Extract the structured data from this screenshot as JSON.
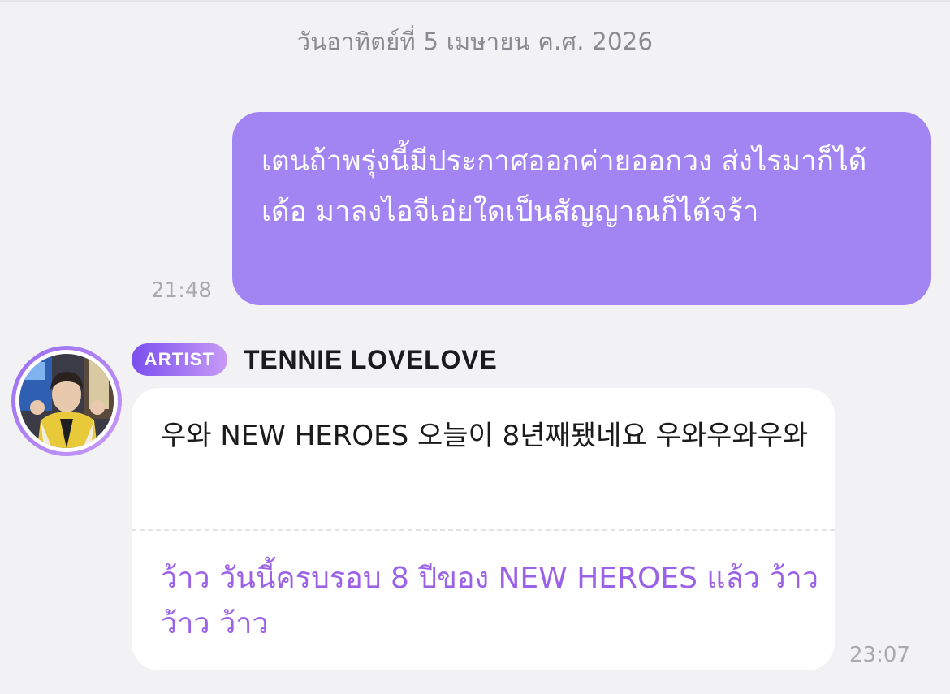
{
  "date_divider": "วันอาทิตย์ที่ 5 เมษายน ค.ศ. 2026",
  "sent_message": {
    "text": "เตนถ้าพรุ่งนี้มีประกาศออกค่ายออกวง ส่งไรมาก็ได้เด้อ มาลงไอจีเอ่ยใดเป็นสัญญาณก็ได้จร้า",
    "time": "21:48",
    "bubble_color": "#a284f3"
  },
  "received_message": {
    "badge": "ARTIST",
    "sender": "TENNIE LOVELOVE",
    "original_text": "우와 NEW HEROES 오늘이 8년째됐네요 우와우와우와",
    "translated_text": "ว้าว วันนี้ครบรอบ 8 ปีของ NEW HEROES แล้ว ว้าว ว้าว ว้าว",
    "time": "23:07",
    "translation_color": "#9b62e8",
    "avatar_icon": "artist-avatar"
  },
  "colors": {
    "background": "#f2f2f4",
    "accent": "#a284f3",
    "badge_gradient_start": "#7a4fee",
    "badge_gradient_end": "#c79af6"
  }
}
